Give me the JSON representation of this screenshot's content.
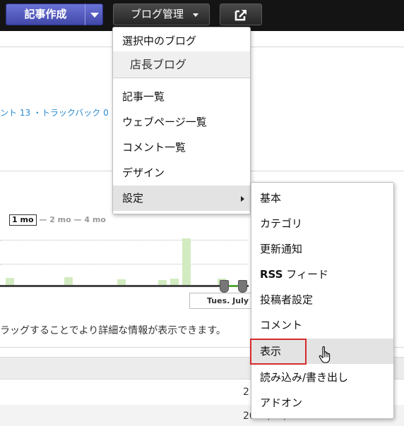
{
  "toolbar": {
    "compose_label": "記事作成",
    "blog_mgmt_label": "ブログ管理",
    "icons": [
      "chevron-down-icon",
      "external-link-icon"
    ]
  },
  "background": {
    "counts_text": "ント 13 ・トラックバック 0",
    "zoom": {
      "selected": "1 mo",
      "others": "— 2 mo — 4 mo"
    },
    "chart_date": "Tues. July",
    "help_text": "ラッグすることでより詳細な情報が表示できます。",
    "table_cell_1": "2",
    "table_cell_2": "2015/07/29"
  },
  "blog_menu": {
    "section_label": "選択中のブログ",
    "current_blog": "店長ブログ",
    "items": [
      {
        "label": "記事一覧"
      },
      {
        "label": "ウェブページ一覧"
      },
      {
        "label": "コメント一覧"
      },
      {
        "label": "デザイン"
      },
      {
        "label": "設定"
      }
    ]
  },
  "settings_menu": {
    "items": [
      {
        "label": "基本"
      },
      {
        "label": "カテゴリ"
      },
      {
        "label": "更新通知"
      },
      {
        "label_bold": "RSS",
        "label_rest": " フィード"
      },
      {
        "label": "投稿者設定"
      },
      {
        "label": "コメント"
      },
      {
        "label": "表示"
      },
      {
        "label": "読み込み/書き出し"
      },
      {
        "label": "アドオン"
      }
    ]
  },
  "colors": {
    "highlight": "#d52b2b",
    "compose_button": "#5158bd",
    "link": "#2a8bd1"
  }
}
